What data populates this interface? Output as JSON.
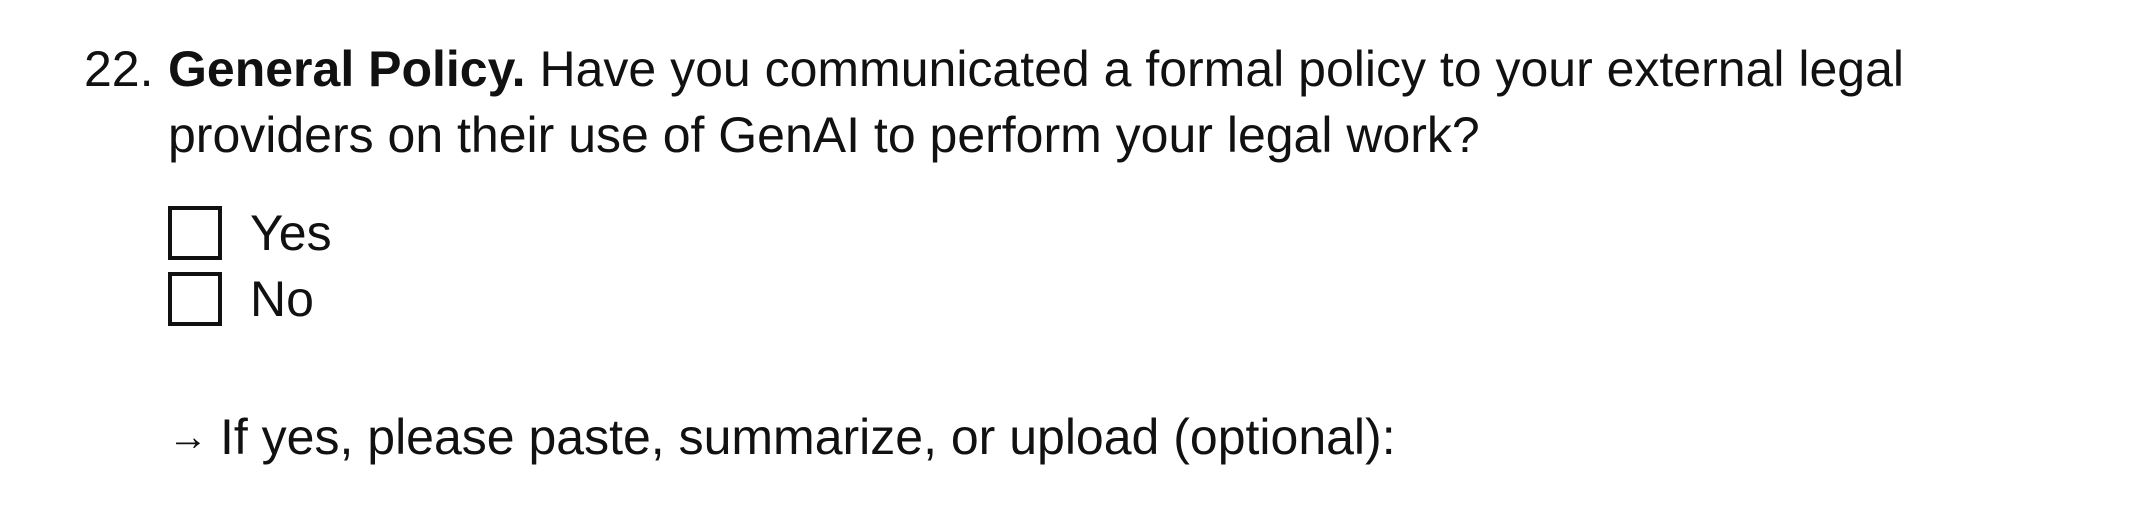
{
  "question": {
    "number": "22.",
    "title": "General Policy.",
    "text": " Have you communicated a formal policy to your external legal providers on their use of GenAI to perform your legal work?"
  },
  "options": [
    {
      "label": "Yes",
      "checked": false
    },
    {
      "label": "No",
      "checked": false
    }
  ],
  "followup": {
    "arrow": "→",
    "text": "If yes, please paste, summarize, or upload (optional):"
  }
}
